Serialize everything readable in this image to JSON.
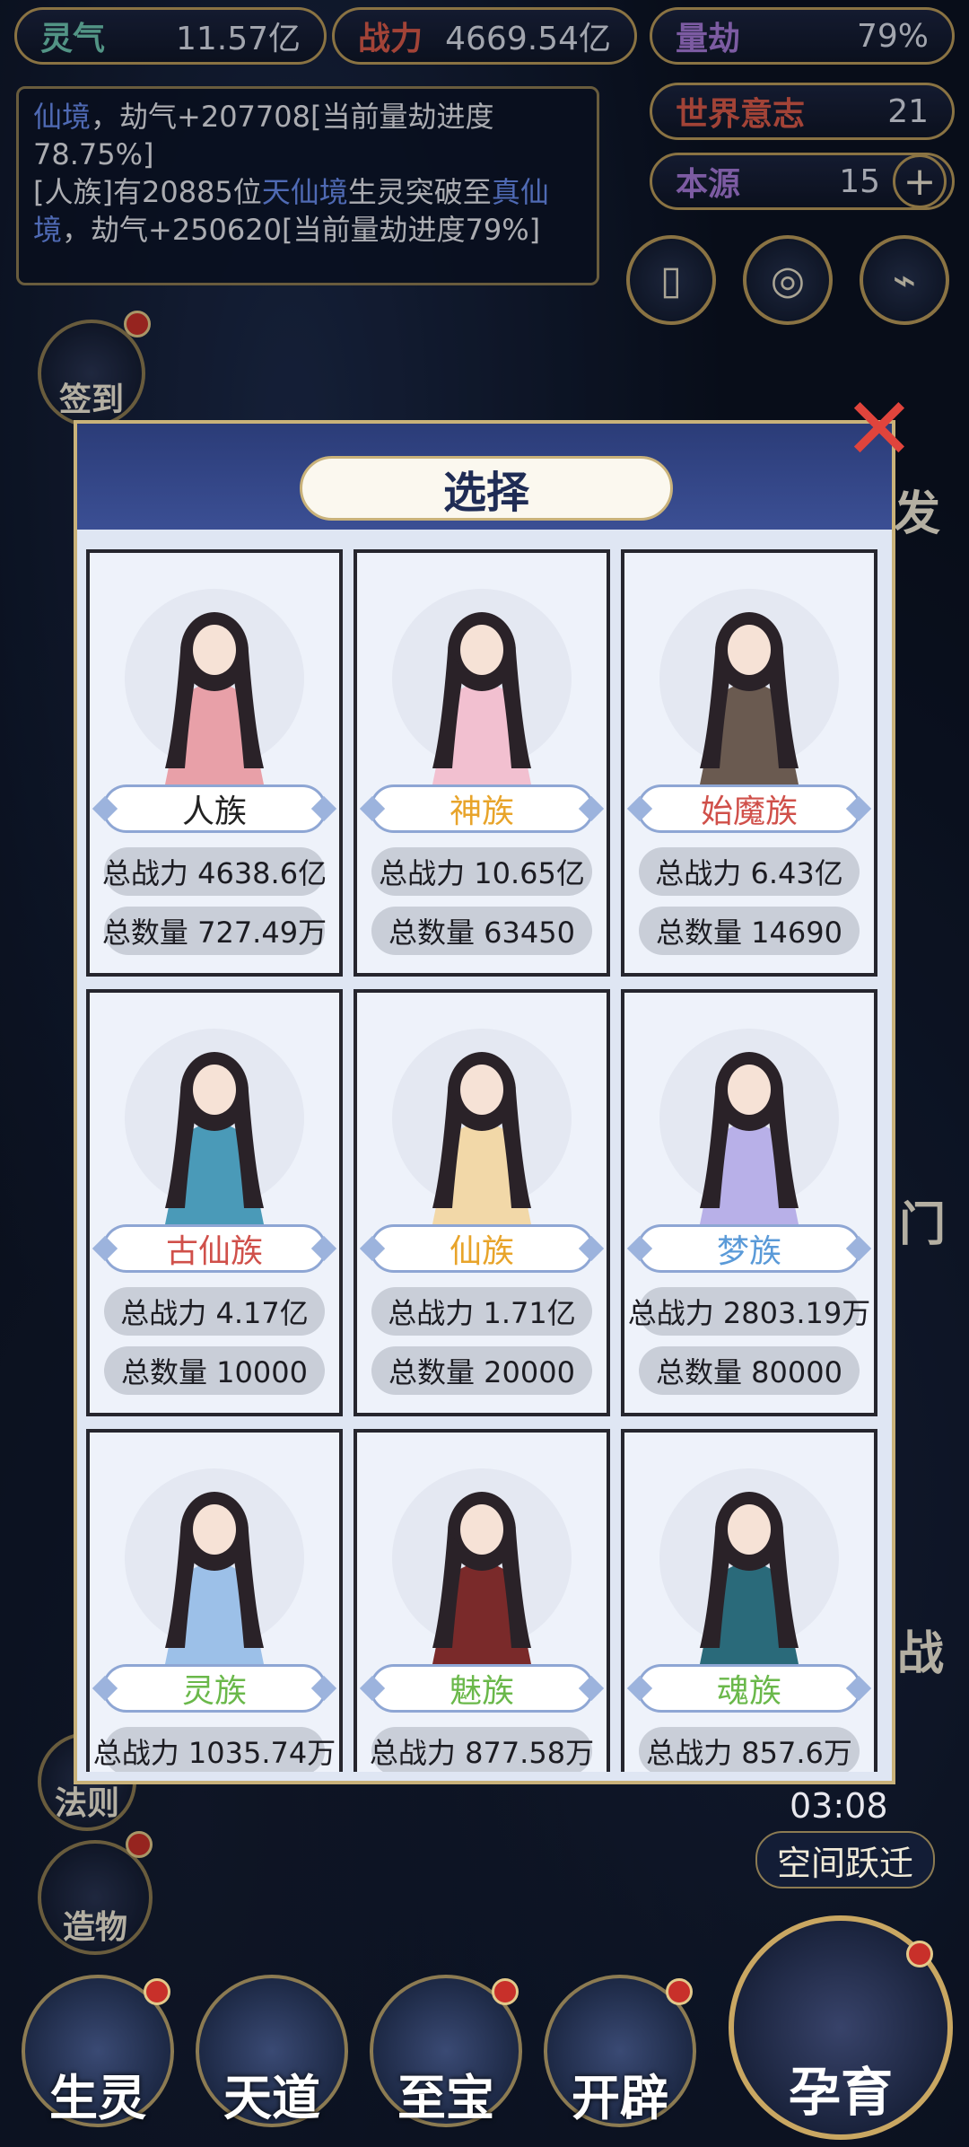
{
  "top_stats": {
    "lingqi_label": "灵气",
    "lingqi_value": "11.57亿",
    "zhanli_label": "战力",
    "zhanli_value": "4669.54亿",
    "liangjie_label": "量劫",
    "liangjie_value": "79%",
    "world_will_label": "世界意志",
    "world_will_value": "21",
    "origin_label": "本源",
    "origin_value": "15"
  },
  "log": {
    "line1_hl": "仙境",
    "line1_rest": "，劫气+207708[当前量劫进度78.75%]",
    "line2_a": "[人族]有20885位",
    "line2_hl1": "天仙境",
    "line2_b": "生灵突破至",
    "line2_hl2": "真仙境",
    "line2_c": "，劫气+250620[当前量劫进度79%]"
  },
  "side_labels": {
    "signin": "签到",
    "fa": "发",
    "law": "法则",
    "create": "造物",
    "men": "门",
    "zhan": "战"
  },
  "modal": {
    "title": "选择"
  },
  "races": [
    {
      "name": "人族",
      "color": "#222222",
      "power": "总战力 4638.6亿",
      "count": "总数量 727.49万"
    },
    {
      "name": "神族",
      "color": "#e8a42a",
      "power": "总战力 10.65亿",
      "count": "总数量 63450"
    },
    {
      "name": "始魔族",
      "color": "#d0504a",
      "power": "总战力 6.43亿",
      "count": "总数量 14690"
    },
    {
      "name": "古仙族",
      "color": "#d0504a",
      "power": "总战力 4.17亿",
      "count": "总数量 10000"
    },
    {
      "name": "仙族",
      "color": "#e8a42a",
      "power": "总战力 1.71亿",
      "count": "总数量 20000"
    },
    {
      "name": "梦族",
      "color": "#5a9ad8",
      "power": "总战力 2803.19万",
      "count": "总数量 80000"
    },
    {
      "name": "灵族",
      "color": "#6ab84a",
      "power": "总战力 1035.74万",
      "count": ""
    },
    {
      "name": "魅族",
      "color": "#6ab84a",
      "power": "总战力 877.58万",
      "count": ""
    },
    {
      "name": "魂族",
      "color": "#6ab84a",
      "power": "总战力 857.6万",
      "count": ""
    }
  ],
  "timer": "03:08",
  "space_jump": "空间跃迁",
  "nav": {
    "shengling": "生灵",
    "tiandao": "天道",
    "zhibao": "至宝",
    "kaipi": "开辟",
    "yunyu": "孕育"
  }
}
